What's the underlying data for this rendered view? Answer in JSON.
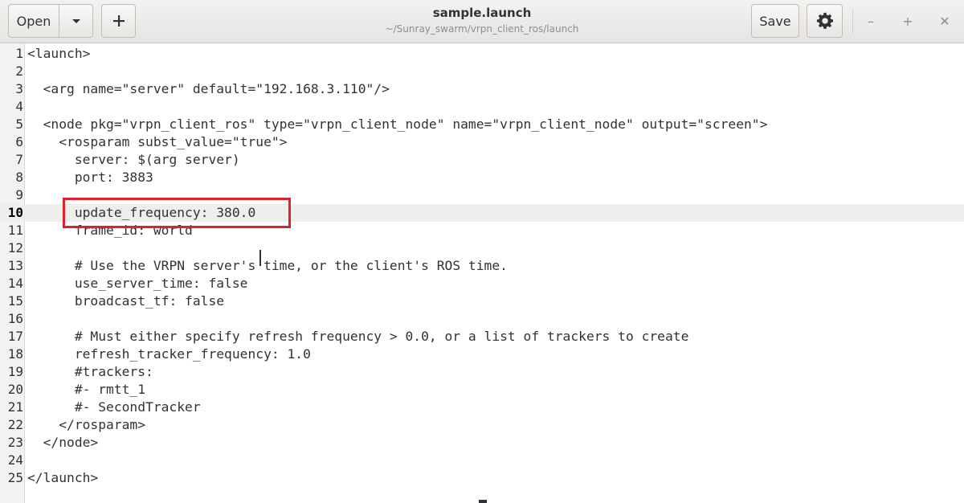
{
  "header": {
    "open_label": "Open",
    "open_menu_icon": "chevron-down-icon",
    "new_icon": "plus-icon",
    "title": "sample.launch",
    "subtitle": "~/Sunray_swarm/vrpn_client_ros/launch",
    "save_label": "Save",
    "gear_icon": "gear-icon",
    "minimize_glyph": "–",
    "maximize_glyph": "+",
    "close_glyph": "✕"
  },
  "editor": {
    "current_line": "10",
    "lines": [
      {
        "n": "1",
        "text": "<launch>"
      },
      {
        "n": "2",
        "text": ""
      },
      {
        "n": "3",
        "text": "  <arg name=\"server\" default=\"192.168.3.110\"/>"
      },
      {
        "n": "4",
        "text": ""
      },
      {
        "n": "5",
        "text": "  <node pkg=\"vrpn_client_ros\" type=\"vrpn_client_node\" name=\"vrpn_client_node\" output=\"screen\">"
      },
      {
        "n": "6",
        "text": "    <rosparam subst_value=\"true\">"
      },
      {
        "n": "7",
        "text": "      server: $(arg server)"
      },
      {
        "n": "8",
        "text": "      port: 3883"
      },
      {
        "n": "9",
        "text": ""
      },
      {
        "n": "10",
        "text": "      update_frequency: 380.0"
      },
      {
        "n": "11",
        "text": "      frame_id: world"
      },
      {
        "n": "12",
        "text": ""
      },
      {
        "n": "13",
        "text": "      # Use the VRPN server's time, or the client's ROS time."
      },
      {
        "n": "14",
        "text": "      use_server_time: false"
      },
      {
        "n": "15",
        "text": "      broadcast_tf: false"
      },
      {
        "n": "16",
        "text": ""
      },
      {
        "n": "17",
        "text": "      # Must either specify refresh frequency > 0.0, or a list of trackers to create"
      },
      {
        "n": "18",
        "text": "      refresh_tracker_frequency: 1.0"
      },
      {
        "n": "19",
        "text": "      #trackers:"
      },
      {
        "n": "20",
        "text": "      #- rmtt_1"
      },
      {
        "n": "21",
        "text": "      #- SecondTracker"
      },
      {
        "n": "22",
        "text": "    </rosparam>"
      },
      {
        "n": "23",
        "text": "  </node>"
      },
      {
        "n": "24",
        "text": ""
      },
      {
        "n": "25",
        "text": "</launch>"
      }
    ]
  },
  "colors": {
    "highlight_box": "#e0202a",
    "current_line_bg": "#eeeeec",
    "text": "#2e3436"
  }
}
